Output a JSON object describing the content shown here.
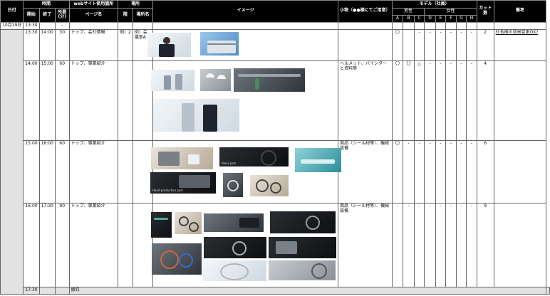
{
  "headers": {
    "date": "日付",
    "time": "時間",
    "start": "開始",
    "end": "終了",
    "duration_line1": "所要",
    "duration_line2": "(分)",
    "website": "webサイト使用箇所",
    "page_name": "ページ名",
    "place": "場所",
    "floor": "階",
    "place_name": "場所名",
    "image": "イメージ",
    "props": "小物（●●様にてご用意）",
    "model": "モデル（社員）",
    "male": "男性",
    "female": "女性",
    "letters": [
      "A",
      "B",
      "C",
      "D",
      "E",
      "F",
      "G",
      "H"
    ],
    "cuts_line1": "カット",
    "cuts_line2": "数",
    "remarks": "備考"
  },
  "first_row": {
    "date": "10月19日",
    "start": "13:30",
    "duration": "-"
  },
  "rows": [
    {
      "start": "13:30",
      "end": "14:00",
      "duration": "30",
      "page": "トップ、会社情報",
      "floor": "例）2",
      "place": "例）会議室A",
      "props": "",
      "models": [
        "〇",
        "",
        "-",
        "-",
        "-",
        "-",
        "-",
        "-"
      ],
      "cuts": "2",
      "remarks": "社長様の背景変更OK?",
      "images": [
        {
          "name": "executive-portrait-photo",
          "style": "pale"
        },
        {
          "name": "office-building-photo",
          "style": "blue"
        }
      ]
    },
    {
      "start": "14:00",
      "end": "15:00",
      "duration": "60",
      "page": "トップ、事業紹介",
      "floor": "",
      "place": "",
      "props": "ヘルメット、バインダーと資料等",
      "models": [
        "〇",
        "〇",
        "△",
        "-",
        "-",
        "-",
        "-",
        "-"
      ],
      "cuts": "4",
      "remarks": "",
      "images": [
        {
          "name": "staff-meeting-photo",
          "style": "pale"
        },
        {
          "name": "helmet-workers-photo",
          "style": "gray"
        },
        {
          "name": "factory-line-photo",
          "style": "steel"
        },
        {
          "name": "handshake-photo",
          "style": "pale"
        }
      ]
    },
    {
      "start": "15:00",
      "end": "16:00",
      "duration": "60",
      "page": "トップ、事業紹介",
      "floor": "",
      "place": "",
      "props": "商品（シール材等）、機械設備",
      "models": [
        "〇",
        "-",
        "-",
        "-",
        "-",
        "-",
        "-",
        "-"
      ],
      "cuts": "6",
      "remarks": "",
      "images": [
        {
          "name": "machine-work-photo",
          "style": "warm"
        },
        {
          "name": "press-part-photo",
          "style": "dark",
          "caption": "Press part"
        },
        {
          "name": "clean-room-photo",
          "style": "teal"
        },
        {
          "name": "hand-production-photo",
          "style": "dark",
          "caption": "Hand production part"
        },
        {
          "name": "product-card-photo",
          "style": "steel"
        },
        {
          "name": "seal-rings-photo",
          "style": "warm"
        }
      ]
    },
    {
      "start": "16:00",
      "end": "17:30",
      "duration": "90",
      "page": "トップ、事業紹介",
      "floor": "",
      "place": "",
      "props": "商品（シール材等）、機械設備",
      "models": [
        "-",
        "-",
        "-",
        "-",
        "-",
        "-",
        "-",
        "-"
      ],
      "cuts": "9",
      "remarks": "",
      "images": [
        {
          "name": "catalog-photo",
          "style": "dark"
        },
        {
          "name": "orings-photo",
          "style": "warm"
        },
        {
          "name": "product-banner-photo",
          "style": "steel"
        },
        {
          "name": "gaskets-photo",
          "style": "dark"
        },
        {
          "name": "colored-parts-photo",
          "style": "steel"
        },
        {
          "name": "seal-lineup-photo",
          "style": "dark"
        },
        {
          "name": "machined-part-photo",
          "style": "dark"
        },
        {
          "name": "large-seal-photo",
          "style": "pale"
        },
        {
          "name": "machine-equipment-photo",
          "style": "gray"
        }
      ]
    }
  ],
  "last_row": {
    "start": "17:30",
    "label": "撤収"
  }
}
